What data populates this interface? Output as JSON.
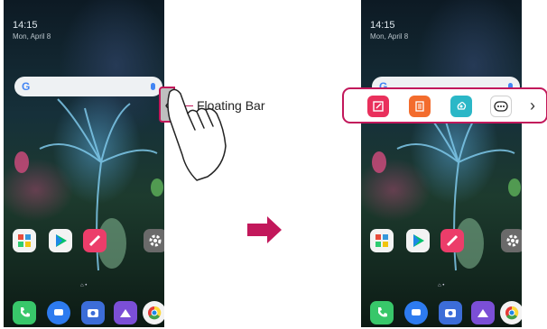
{
  "callout": {
    "label": "Floating Bar"
  },
  "handle": {
    "glyph": "‹"
  },
  "floating_bar": {
    "items": [
      {
        "icon": "edit-note-icon",
        "color": "#e9305c"
      },
      {
        "icon": "memo-list-icon",
        "color": "#f36c2d"
      },
      {
        "icon": "capture-icon",
        "color": "#2bb7c7"
      },
      {
        "icon": "more-icon",
        "color": "#ffffff"
      }
    ],
    "next_glyph": "›"
  },
  "home_apps": [
    {
      "name": "folder",
      "color": "#f3f3f3"
    },
    {
      "name": "play-store",
      "color": "#f3f3f3"
    },
    {
      "name": "pen",
      "color": "#ec3d6a"
    },
    {
      "name": "settings",
      "color": "#6a6a6a"
    }
  ],
  "dock_apps": [
    {
      "name": "phone",
      "color": "#38c76a"
    },
    {
      "name": "messages",
      "color": "#2d7bef"
    },
    {
      "name": "camera",
      "color": "#3c6dd8"
    },
    {
      "name": "gallery",
      "color": "#7b4fd6"
    },
    {
      "name": "chrome",
      "color": "#f3f3f3"
    }
  ],
  "accent": "#c2185b"
}
